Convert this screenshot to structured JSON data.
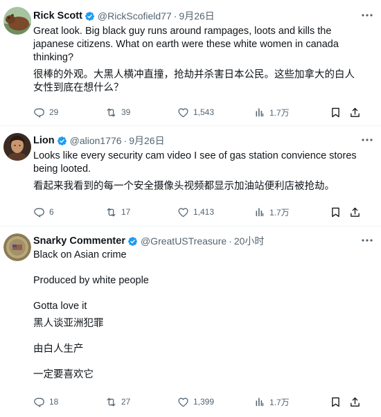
{
  "tweets": [
    {
      "name": "Rick Scott",
      "handle": "@RickScofield77",
      "dot": "·",
      "time": "9月26日",
      "text": [
        "Great look. Big black guy runs around rampages, loots and kills the japanese citizens. What on earth were these white women in canada thinking?",
        "很棒的外观。大黑人横冲直撞，抢劫并杀害日本公民。这些加拿大的白人女性到底在想什么？"
      ],
      "replies": "29",
      "retweets": "39",
      "likes": "1,543",
      "views": "1.7万"
    },
    {
      "name": "Lion",
      "handle": "@alion1776",
      "dot": "·",
      "time": "9月26日",
      "text": [
        "Looks like every security cam video I see of gas station convience stores being looted.",
        "看起来我看到的每一个安全摄像头视频都显示加油站便利店被抢劫。"
      ],
      "replies": "6",
      "retweets": "17",
      "likes": "1,413",
      "views": "1.7万"
    },
    {
      "name": "Snarky Commenter",
      "handle": "@GreatUSTreasure",
      "dot": "·",
      "time": "20小时",
      "text": [
        "Black on Asian crime",
        "Produced by white people",
        "Gotta love it",
        "黑人谈亚洲犯罪",
        "由白人生产",
        "一定要喜欢它"
      ],
      "replies": "18",
      "retweets": "27",
      "likes": "1,399",
      "views": "1.7万"
    }
  ],
  "colors": {
    "text": "#0f1419",
    "muted": "#536471",
    "verified": "#1d9bf0",
    "divider": "#eff3f4"
  },
  "icons": [
    "verified-badge-icon",
    "more-icon",
    "reply-icon",
    "retweet-icon",
    "like-icon",
    "views-icon",
    "bookmark-icon",
    "share-icon"
  ]
}
